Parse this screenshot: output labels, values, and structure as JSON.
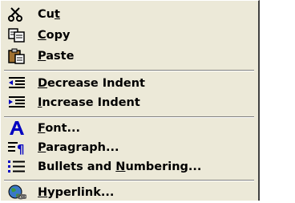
{
  "menu": {
    "items": [
      {
        "key": "cut",
        "icon": "scissors-icon",
        "label": "Cut",
        "pre": "Cu",
        "access": "t",
        "post": ""
      },
      {
        "key": "copy",
        "icon": "copy-icon",
        "label": "Copy",
        "pre": "",
        "access": "C",
        "post": "opy"
      },
      {
        "key": "paste",
        "icon": "clipboard-paste-icon",
        "label": "Paste",
        "pre": "",
        "access": "P",
        "post": "aste"
      },
      {
        "key": "decrease-indent",
        "icon": "decrease-indent-icon",
        "label": "Decrease Indent",
        "pre": "",
        "access": "D",
        "post": "ecrease Indent"
      },
      {
        "key": "increase-indent",
        "icon": "increase-indent-icon",
        "label": "Increase Indent",
        "pre": "",
        "access": "I",
        "post": "ncrease Indent"
      },
      {
        "key": "font",
        "icon": "font-a-icon",
        "label": "Font...",
        "pre": "",
        "access": "F",
        "post": "ont..."
      },
      {
        "key": "paragraph",
        "icon": "paragraph-icon",
        "label": "Paragraph...",
        "pre": "",
        "access": "P",
        "post": "aragraph..."
      },
      {
        "key": "bullets-numbering",
        "icon": "bullets-numbering-icon",
        "label": "Bullets and Numbering...",
        "pre": "Bullets and ",
        "access": "N",
        "post": "umbering..."
      },
      {
        "key": "hyperlink",
        "icon": "hyperlink-globe-icon",
        "label": "Hyperlink...",
        "pre": "",
        "access": "H",
        "post": "yperlink..."
      }
    ]
  },
  "colors": {
    "menu_background": "#ece9d8",
    "accent_blue": "#0000c0",
    "separator_dark": "#808080"
  }
}
